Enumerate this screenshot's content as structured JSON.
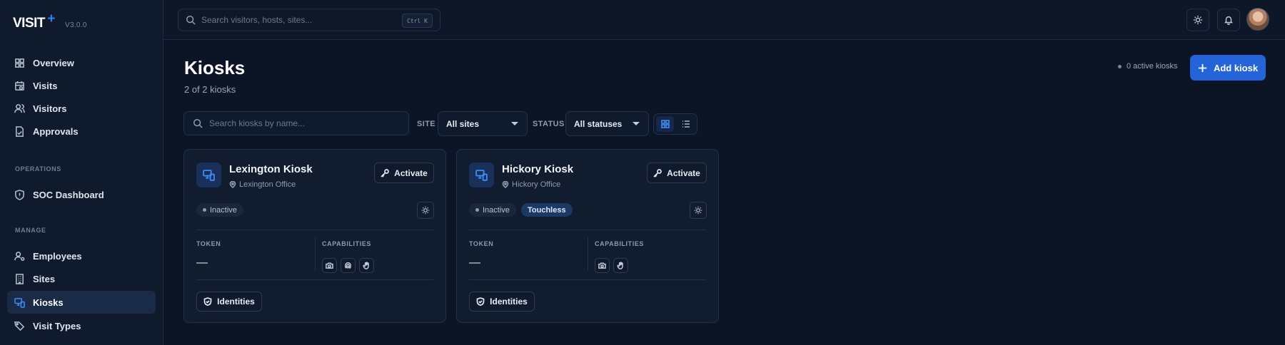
{
  "app": {
    "logo": "VISIT",
    "logo_plus": "+",
    "version": "V3.0.0"
  },
  "sidebar": {
    "items_main": [
      {
        "label": "Overview",
        "icon": "grid-icon"
      },
      {
        "label": "Visits",
        "icon": "calendar-clock-icon"
      },
      {
        "label": "Visitors",
        "icon": "users-icon"
      },
      {
        "label": "Approvals",
        "icon": "file-check-icon"
      }
    ],
    "section_operations": "OPERATIONS",
    "items_operations": [
      {
        "label": "SOC Dashboard",
        "icon": "shield-icon"
      }
    ],
    "section_manage": "MANAGE",
    "items_manage": [
      {
        "label": "Employees",
        "icon": "user-cog-icon"
      },
      {
        "label": "Sites",
        "icon": "building-icon"
      },
      {
        "label": "Kiosks",
        "icon": "monitor-smartphone-icon",
        "active": true
      },
      {
        "label": "Visit Types",
        "icon": "tags-icon"
      }
    ]
  },
  "topbar": {
    "search_placeholder": "Search visitors, hosts, sites...",
    "shortcut": "Ctrl K"
  },
  "page": {
    "title": "Kiosks",
    "subtitle": "2 of 2 kiosks",
    "active_count": "0 active kiosks",
    "add_button": "Add kiosk"
  },
  "filters": {
    "search_placeholder": "Search kiosks by name...",
    "site_label": "SITE",
    "site_value": "All sites",
    "status_label": "STATUS",
    "status_value": "All statuses"
  },
  "kiosks": [
    {
      "name": "Lexington Kiosk",
      "location": "Lexington Office",
      "activate": "Activate",
      "status": "Inactive",
      "touchless": "",
      "token_label": "TOKEN",
      "token": "—",
      "capabilities_label": "CAPABILITIES",
      "capabilities": [
        "camera-icon",
        "fingerprint-icon",
        "hand-icon"
      ],
      "identities": "Identities"
    },
    {
      "name": "Hickory Kiosk",
      "location": "Hickory Office",
      "activate": "Activate",
      "status": "Inactive",
      "touchless": "Touchless",
      "token_label": "TOKEN",
      "token": "—",
      "capabilities_label": "CAPABILITIES",
      "capabilities": [
        "camera-icon",
        "hand-icon"
      ],
      "identities": "Identities"
    }
  ],
  "colors": {
    "accent": "#2563d8",
    "background": "#0c1526",
    "active_nav": "#1a2b48"
  }
}
